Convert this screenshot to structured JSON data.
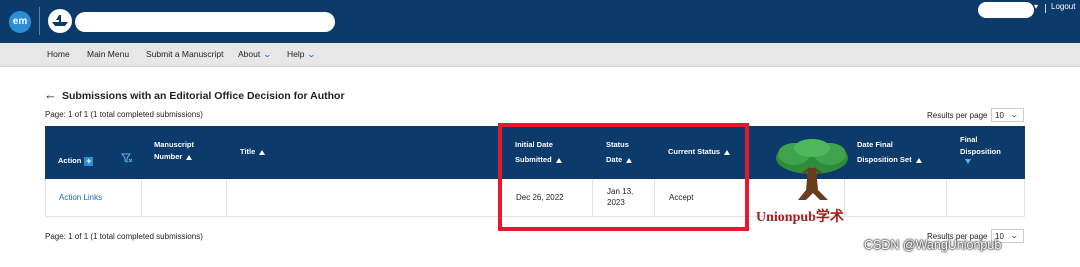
{
  "header": {
    "logo_text": "em",
    "logout_label": "Logout"
  },
  "nav": {
    "items": [
      {
        "label": "Home"
      },
      {
        "label": "Main Menu"
      },
      {
        "label": "Submit a Manuscript"
      },
      {
        "label": "About",
        "icon": "chevron-down-icon"
      },
      {
        "label": "Help",
        "icon": "chevron-down-icon"
      }
    ]
  },
  "page": {
    "title": "Submissions with an Editorial Office Decision for Author",
    "page_info_top": "Page: 1 of 1 (1 total completed submissions)",
    "page_info_bottom": "Page: 1 of 1 (1 total completed submissions)",
    "results_per_page_label": "Results per page",
    "results_per_page_value": "10"
  },
  "table": {
    "columns": [
      {
        "line1": "Action",
        "line2": ""
      },
      {
        "line1": "Manuscript",
        "line2": "Number"
      },
      {
        "line1": "Title",
        "line2": ""
      },
      {
        "line1": "Initial Date",
        "line2": "Submitted"
      },
      {
        "line1": "Status",
        "line2": "Date"
      },
      {
        "line1": "Current Status",
        "line2": ""
      },
      {
        "line1": "Date Final",
        "line2": "Disposition Set"
      },
      {
        "line1": "Final",
        "line2": "Disposition"
      }
    ],
    "rows": [
      {
        "action": "Action Links",
        "manuscript_number": "",
        "title": "",
        "initial_date_submitted": "Dec 26, 2022",
        "status_date_line1": "Jan 13,",
        "status_date_line2": "2023",
        "current_status": "Accept",
        "date_final_disposition_set": "",
        "final_disposition": ""
      }
    ]
  },
  "watermark": {
    "brand": "Unionpub学术",
    "csdn": "CSDN @WangUnionpub"
  },
  "colors": {
    "header_bg": "#0b3a6b",
    "highlight_border": "#e8182c",
    "link": "#1a6bbf"
  }
}
